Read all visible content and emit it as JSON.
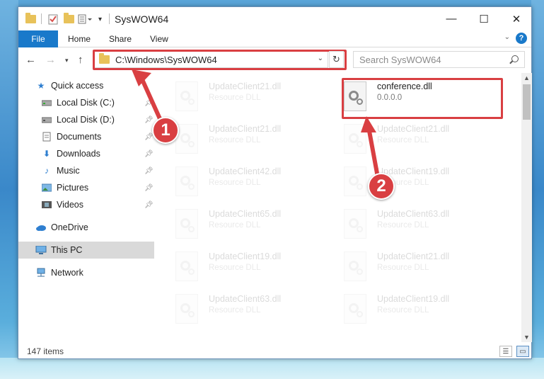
{
  "window": {
    "title": "SysWOW64",
    "controls": {
      "minimize": "—",
      "maximize": "☐",
      "close": "✕"
    }
  },
  "ribbon": {
    "file": "File",
    "tabs": [
      "Home",
      "Share",
      "View"
    ],
    "help": "?"
  },
  "nav": {
    "address": "C:\\Windows\\SysWOW64",
    "search_placeholder": "Search SysWOW64"
  },
  "sidebar": {
    "items": [
      {
        "label": "Quick access",
        "icon": "star-icon"
      },
      {
        "label": "Local Disk (C:)",
        "icon": "drive-icon",
        "pinned": true
      },
      {
        "label": "Local Disk (D:)",
        "icon": "drive-icon",
        "pinned": true
      },
      {
        "label": "Documents",
        "icon": "documents-icon",
        "pinned": true
      },
      {
        "label": "Downloads",
        "icon": "download-icon",
        "pinned": true
      },
      {
        "label": "Music",
        "icon": "music-icon",
        "pinned": true
      },
      {
        "label": "Pictures",
        "icon": "pictures-icon",
        "pinned": true
      },
      {
        "label": "Videos",
        "icon": "videos-icon",
        "pinned": true
      },
      {
        "label": "OneDrive",
        "icon": "cloud-icon"
      },
      {
        "label": "This PC",
        "icon": "computer-icon",
        "selected": true
      },
      {
        "label": "Network",
        "icon": "network-icon"
      }
    ]
  },
  "files": {
    "highlighted": {
      "name": "conference.dll",
      "sub": "0.0.0.0"
    },
    "left_column": [
      {
        "name": "UpdateClient21.dll",
        "sub": "Resource DLL"
      },
      {
        "name": "UpdateClient21.dll",
        "sub": "Resource DLL"
      },
      {
        "name": "UpdateClient42.dll",
        "sub": "Resource DLL"
      },
      {
        "name": "UpdateClient65.dll",
        "sub": "Resource DLL"
      },
      {
        "name": "UpdateClient19.dll",
        "sub": "Resource DLL"
      },
      {
        "name": "UpdateClient63.dll",
        "sub": "Resource DLL"
      }
    ],
    "right_column": [
      {
        "name": "UpdateClient21.dll",
        "sub": "Resource DLL"
      },
      {
        "name": "UpdateClient19.dll",
        "sub": "Resource DLL"
      },
      {
        "name": "UpdateClient63.dll",
        "sub": "Resource DLL"
      },
      {
        "name": "UpdateClient21.dll",
        "sub": "Resource DLL"
      },
      {
        "name": "UpdateClient19.dll",
        "sub": "Resource DLL"
      }
    ]
  },
  "status": {
    "count": "147 items"
  },
  "annotations": {
    "step1": "1",
    "step2": "2"
  },
  "colors": {
    "accent": "#1979ca",
    "annotation": "#d93f42",
    "selected": "#d9d9d9"
  }
}
